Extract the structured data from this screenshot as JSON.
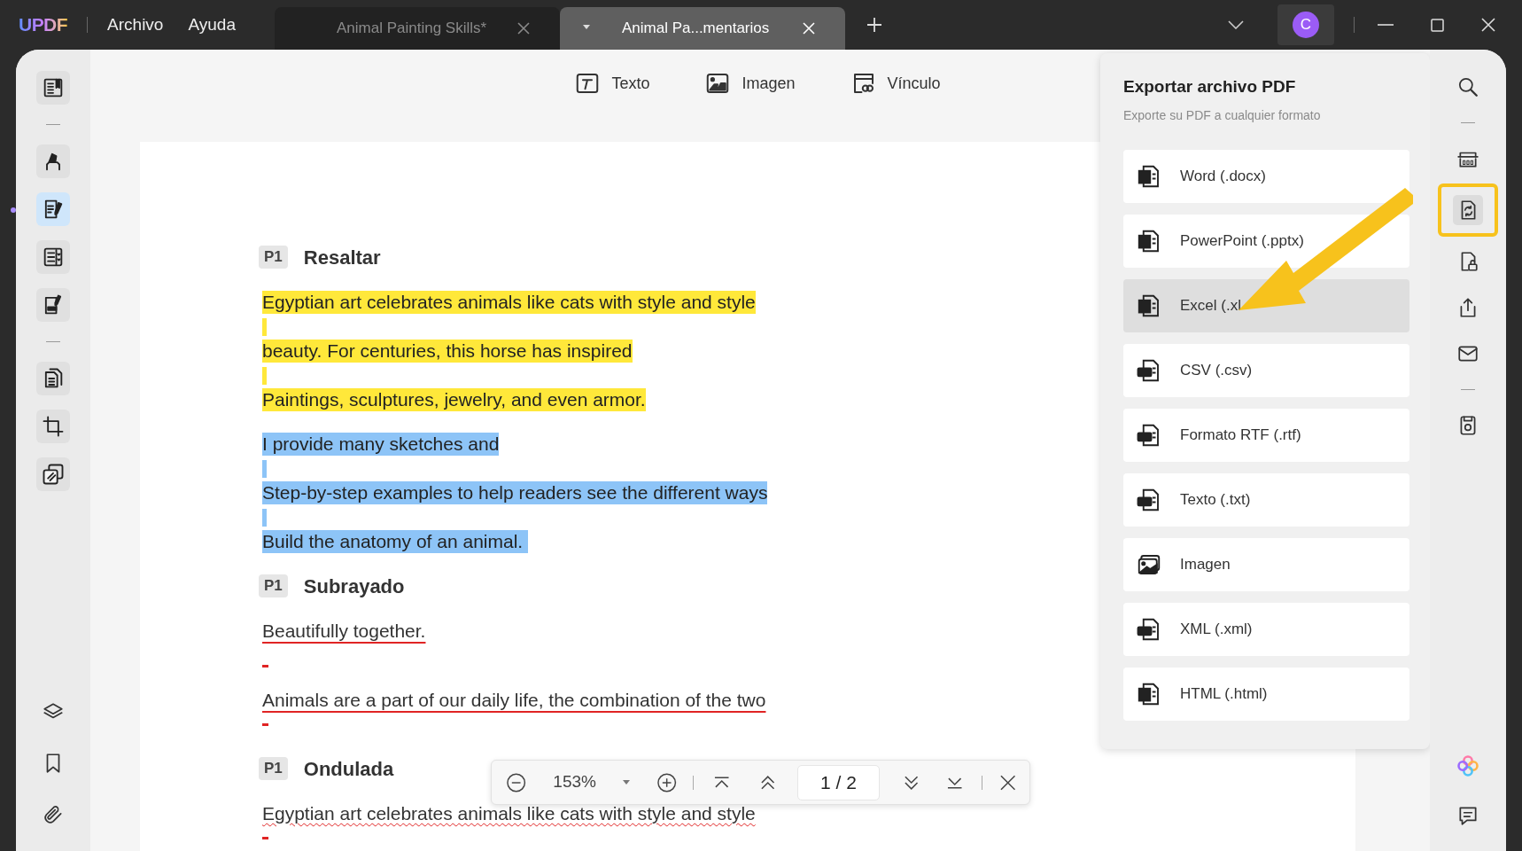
{
  "app": {
    "logo": "UPDF"
  },
  "menu": [
    {
      "label": "Archivo"
    },
    {
      "label": "Ayuda"
    }
  ],
  "tabs": [
    {
      "label": "Animal Painting Skills*",
      "selected": false
    },
    {
      "label": "Animal Pa...mentarios",
      "selected": true
    }
  ],
  "account": {
    "initial": "C"
  },
  "left_tools": [
    [
      {
        "kind": "read",
        "selected": false
      }
    ],
    [
      {
        "kind": "highlight",
        "selected": false
      },
      {
        "kind": "edit",
        "selected": true
      },
      {
        "kind": "form",
        "selected": false
      },
      {
        "kind": "sign",
        "selected": false
      }
    ],
    [
      {
        "kind": "organize",
        "selected": false
      },
      {
        "kind": "crop",
        "selected": false
      },
      {
        "kind": "compare",
        "selected": false
      }
    ]
  ],
  "left_bottom_tools": [
    {
      "kind": "layers"
    },
    {
      "kind": "bookmark"
    },
    {
      "kind": "attachment"
    }
  ],
  "insert_toolbar": [
    {
      "kind": "text",
      "label": "Texto"
    },
    {
      "kind": "image",
      "label": "Imagen"
    },
    {
      "kind": "link",
      "label": "Vínculo"
    }
  ],
  "document": {
    "sections": [
      {
        "badge": "P1",
        "title": "Resaltar",
        "kind": "highlight",
        "lines": [
          {
            "text": "Egyptian art celebrates animals like cats with style and style",
            "color": "#ffe83a"
          },
          {
            "text": "beauty. For centuries, this horse has inspired",
            "color": "#ffe83a"
          },
          {
            "text": "Paintings, sculptures, jewelry, and even armor.",
            "color": "#ffe83a"
          },
          {
            "text": "I provide many sketches and",
            "color": "#8dc4f7"
          },
          {
            "text": "Step-by-step examples to help readers see the different ways",
            "color": "#8dc4f7"
          },
          {
            "text": "Build the anatomy of an animal. ",
            "color": "#8dc4f7"
          }
        ]
      },
      {
        "badge": "P1",
        "title": "Subrayado",
        "kind": "underline",
        "lines": [
          {
            "text": "Beautifully together."
          },
          {
            "text": "Animals are a part of our daily life, the combination of the two"
          }
        ]
      },
      {
        "badge": "P1",
        "title": "Ondulada",
        "kind": "squiggly",
        "lines": [
          {
            "text": "Egyptian art celebrates animals like cats with style and style"
          }
        ]
      }
    ]
  },
  "zoom_bar": {
    "zoom": "153%",
    "page": "1 / 2"
  },
  "export_panel": {
    "title": "Exportar archivo PDF",
    "subtitle": "Exporte su PDF a cualquier formato",
    "formats": [
      {
        "kind": "word",
        "label": "Word (.docx)",
        "selected": false
      },
      {
        "kind": "powerpoint",
        "label": "PowerPoint (.pptx)",
        "selected": false
      },
      {
        "kind": "excel",
        "label": "Excel (.xl",
        "selected": true
      },
      {
        "kind": "csv",
        "label": "CSV (.csv)",
        "selected": false
      },
      {
        "kind": "rtf",
        "label": "Formato RTF (.rtf)",
        "selected": false
      },
      {
        "kind": "txt",
        "label": "Texto (.txt)",
        "selected": false
      },
      {
        "kind": "image",
        "label": "Imagen",
        "selected": false
      },
      {
        "kind": "xml",
        "label": "XML (.xml)",
        "selected": false
      },
      {
        "kind": "html",
        "label": "HTML (.html)",
        "selected": false
      }
    ]
  },
  "right_tools": [
    [
      {
        "kind": "search",
        "selected": false,
        "callout": false
      }
    ],
    [
      {
        "kind": "ocr",
        "selected": false,
        "callout": false
      },
      {
        "kind": "convert",
        "selected": true,
        "callout": true
      },
      {
        "kind": "protect",
        "selected": false,
        "callout": false
      },
      {
        "kind": "share",
        "selected": false,
        "callout": false
      },
      {
        "kind": "mail",
        "selected": false,
        "callout": false
      }
    ],
    [
      {
        "kind": "save",
        "selected": false,
        "callout": false
      }
    ]
  ],
  "right_bottom_tools": [
    {
      "kind": "ai"
    },
    {
      "kind": "comment"
    }
  ]
}
